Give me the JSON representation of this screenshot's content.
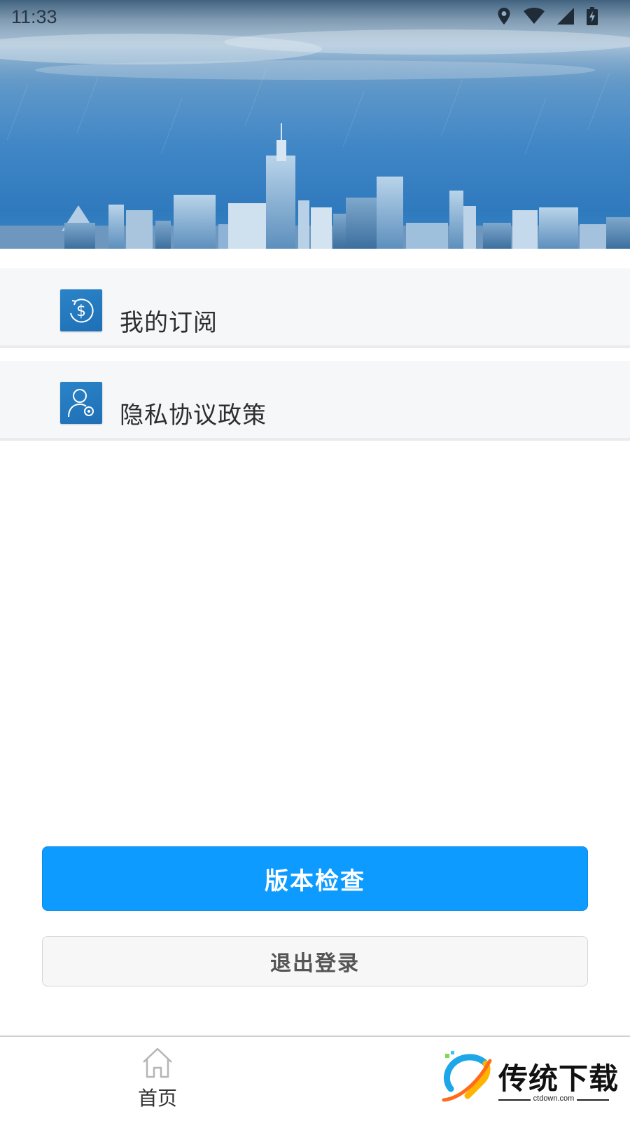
{
  "status_bar": {
    "time": "11:33",
    "icons": [
      "location-icon",
      "wifi-icon",
      "signal-icon",
      "battery-charging-icon"
    ]
  },
  "menu": [
    {
      "label": "我的订阅",
      "icon": "dollar-circle-icon"
    },
    {
      "label": "隐私协议政策",
      "icon": "user-settings-icon"
    }
  ],
  "buttons": {
    "check_version": "版本检查",
    "logout": "退出登录"
  },
  "bottom_nav": {
    "home_label": "首页",
    "home_icon": "home-icon"
  },
  "watermark": {
    "title": "传统下载",
    "domain": "ctdown.com"
  },
  "colors": {
    "primary": "#0e9bff",
    "icon_bg": "#2a84c8",
    "menu_bg": "#f6f7f9"
  }
}
